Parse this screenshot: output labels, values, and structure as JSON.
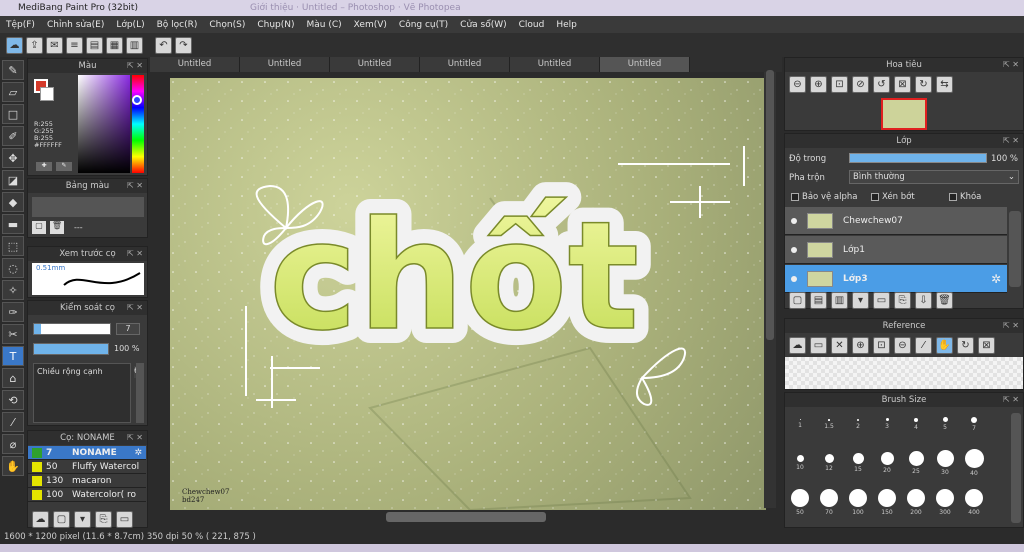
{
  "window": {
    "title": "MediBang Paint Pro (32bit)",
    "bg_tabs": "Giới thiệu  ·  Untitled – Photoshop  ·  Vẽ Photopea"
  },
  "menu": [
    "Tệp(F)",
    "Chỉnh sửa(E)",
    "Lớp(L)",
    "Bộ lọc(R)",
    "Chọn(S)",
    "Chụp(N)",
    "Màu (C)",
    "Xem(V)",
    "Công cụ(T)",
    "Cửa sổ(W)",
    "Cloud",
    "Help"
  ],
  "doc_tabs": [
    "Untitled",
    "Untitled",
    "Untitled",
    "Untitled",
    "Untitled",
    "Untitled"
  ],
  "color_panel": {
    "title": "Màu",
    "rgb": [
      "R:255",
      "G:255",
      "B:255",
      "#FFFFFF"
    ],
    "accent": "#d43a2a"
  },
  "palette_panel": {
    "title": "Bảng màu",
    "empty": "---"
  },
  "brush_preview": {
    "title": "Xem trước cọ",
    "size": "0.51mm"
  },
  "brush_control": {
    "title": "Kiểm soát cọ",
    "size_value": "7",
    "opacity": "100 %",
    "width_label": "Chiều rộng cạnh",
    "width_value": "6"
  },
  "brush_list": {
    "title": "Cọ: NONAME",
    "items": [
      {
        "size": "7",
        "name": "NONAME",
        "color": "#3aa0e0"
      },
      {
        "size": "50",
        "name": "Fluffy Watercol",
        "color": "#e4e400"
      },
      {
        "size": "130",
        "name": "macaron",
        "color": "#e4e400"
      },
      {
        "size": "100",
        "name": "Watercolor( ro",
        "color": "#e4e400"
      }
    ]
  },
  "canvas": {
    "text": "chốt",
    "credit": "Chewchew07\nbd247"
  },
  "navigator": {
    "title": "Hoa tiêu"
  },
  "layers": {
    "title": "Lớp",
    "opacity_label": "Độ trong",
    "opacity_value": "100 %",
    "opacity_fraction": 1.0,
    "blend_label": "Pha trộn",
    "blend_value": "Bình thường",
    "protect_alpha": "Bảo vệ alpha",
    "clipping": "Xén bớt",
    "lock": "Khóa",
    "items": [
      {
        "name": "Chewchew07",
        "selected": false
      },
      {
        "name": "Lớp1",
        "selected": false
      },
      {
        "name": "Lớp3",
        "selected": true
      }
    ]
  },
  "reference": {
    "title": "Reference"
  },
  "brush_size": {
    "title": "Brush Size",
    "sizes": [
      "1",
      "1.5",
      "2",
      "3",
      "4",
      "5",
      "7",
      "10",
      "12",
      "15",
      "20",
      "25",
      "30",
      "40",
      "50",
      "70",
      "100",
      "150",
      "200",
      "300",
      "400"
    ]
  },
  "status": "1600 * 1200 pixel  (11.6 * 8.7cm)  350 dpi  50 %  ( 221, 875 )"
}
